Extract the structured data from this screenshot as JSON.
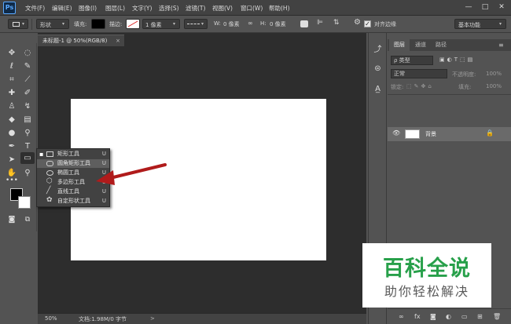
{
  "app": {
    "logo": "Ps"
  },
  "menu": [
    "文件(F)",
    "编辑(E)",
    "图像(I)",
    "图层(L)",
    "文字(Y)",
    "选择(S)",
    "滤镜(T)",
    "视图(V)",
    "窗口(W)",
    "帮助(H)"
  ],
  "window_controls": {
    "minimize": "—",
    "maximize": "□",
    "close": "✕"
  },
  "options": {
    "mode": "形状",
    "fill_label": "填充:",
    "stroke_label": "描边:",
    "stroke_width": "1 像素",
    "w_label": "W:",
    "w_value": "0 像素",
    "h_label": "H:",
    "h_value": "0 像素",
    "align_edges": "对齐边缘",
    "workspace": "基本功能"
  },
  "document": {
    "tab_title": "未标题-1 @ 50%(RGB/8)",
    "tab_close": "×",
    "zoom": "50%",
    "info": "文档:1.98M/0 字节",
    "info_arrow": ">"
  },
  "flyout": {
    "items": [
      {
        "label": "矩形工具",
        "key": "U",
        "selected": true
      },
      {
        "label": "圆角矩形工具",
        "key": "U",
        "selected": false
      },
      {
        "label": "椭圆工具",
        "key": "U",
        "selected": false
      },
      {
        "label": "多边形工具",
        "key": "U",
        "selected": false
      },
      {
        "label": "直线工具",
        "key": "U",
        "selected": false
      },
      {
        "label": "自定形状工具",
        "key": "U",
        "selected": false
      }
    ],
    "bullet": "▪"
  },
  "layers_panel": {
    "tabs": [
      "图层",
      "通道",
      "路径"
    ],
    "kind_label": "ρ 类型",
    "blend_mode": "正常",
    "opacity_label": "不透明度:",
    "opacity_value": "100%",
    "lock_label": "锁定:",
    "fill_label": "填充:",
    "fill_value": "100%",
    "layer_name": "背景"
  },
  "watermark": {
    "title": "百科全说",
    "subtitle": "助你轻松解决"
  },
  "colors": {
    "arrow": "#b01b1b",
    "watermark_green": "#27a04a",
    "foreground": "#000000",
    "background": "#ffffff"
  }
}
